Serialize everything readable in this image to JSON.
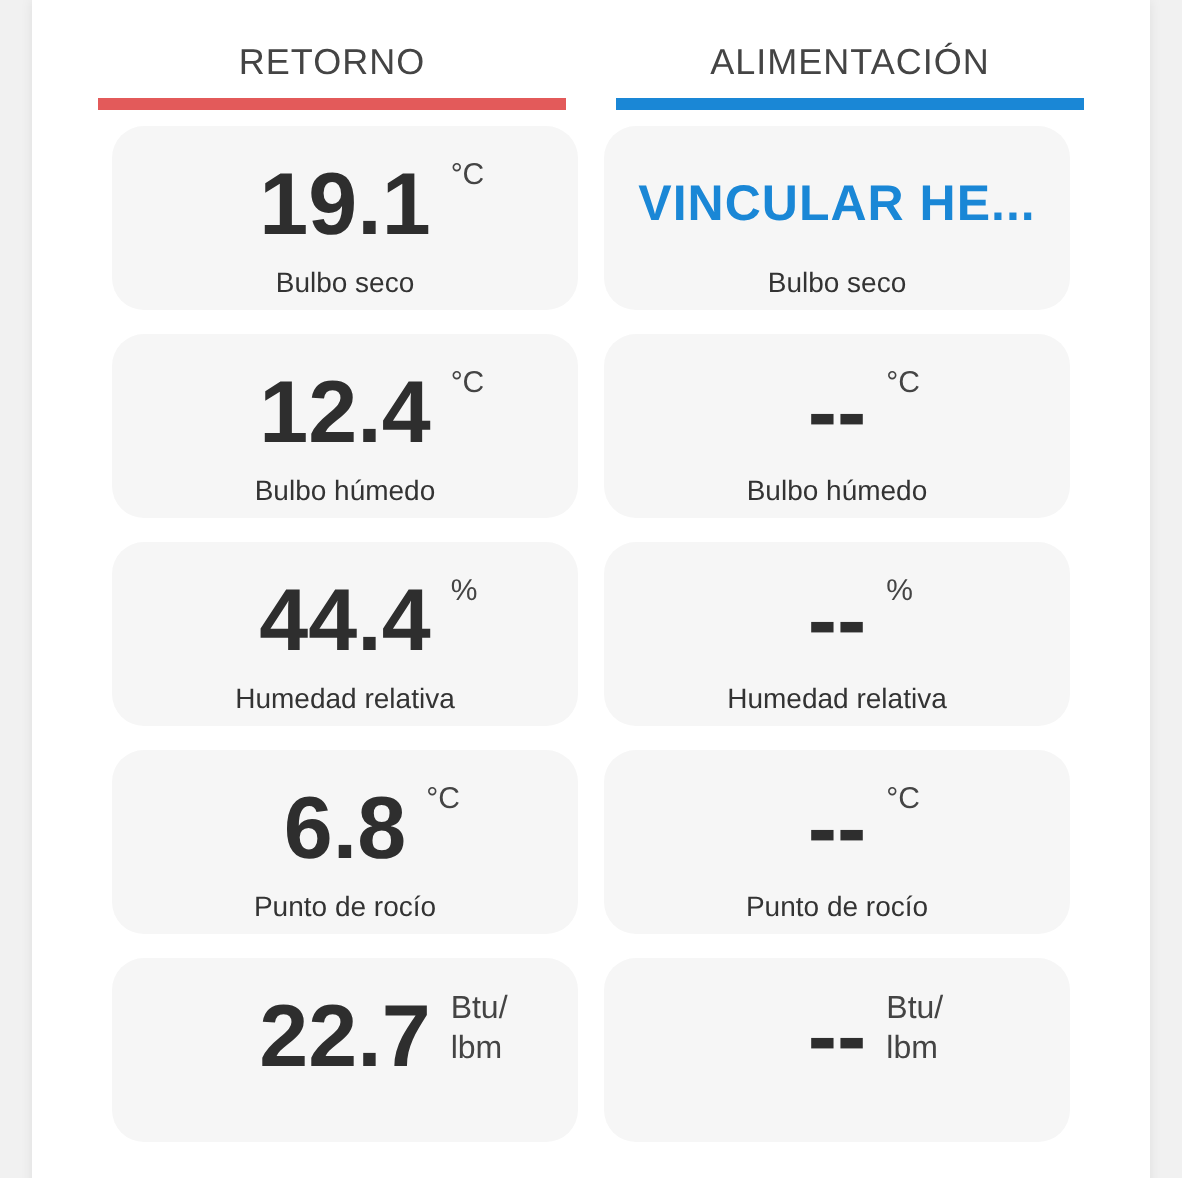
{
  "columns": [
    {
      "title": "RETORNO",
      "color": "#e35a5a"
    },
    {
      "title": "ALIMENTACIÓN",
      "color": "#1a87d6"
    }
  ],
  "rows": [
    {
      "cells": [
        {
          "kind": "reading",
          "value": "19.1",
          "unit": "°C",
          "label": "Bulbo seco"
        },
        {
          "kind": "link",
          "value": "VINCULAR HE...",
          "label": "Bulbo seco"
        }
      ]
    },
    {
      "cells": [
        {
          "kind": "reading",
          "value": "12.4",
          "unit": "°C",
          "label": "Bulbo húmedo"
        },
        {
          "kind": "reading",
          "value": "--",
          "unit": "°C",
          "label": "Bulbo húmedo"
        }
      ]
    },
    {
      "cells": [
        {
          "kind": "reading",
          "value": "44.4",
          "unit": "%",
          "label": "Humedad relativa"
        },
        {
          "kind": "reading",
          "value": "--",
          "unit": "%",
          "label": "Humedad relativa"
        }
      ]
    },
    {
      "cells": [
        {
          "kind": "reading",
          "value": "6.8",
          "unit": "°C",
          "label": "Punto de rocío"
        },
        {
          "kind": "reading",
          "value": "--",
          "unit": "°C",
          "label": "Punto de rocío"
        }
      ]
    },
    {
      "cells": [
        {
          "kind": "reading",
          "value": "22.7",
          "unit": "Btu/\nlbm"
        },
        {
          "kind": "reading",
          "value": "--",
          "unit": "Btu/\nlbm"
        }
      ]
    }
  ]
}
